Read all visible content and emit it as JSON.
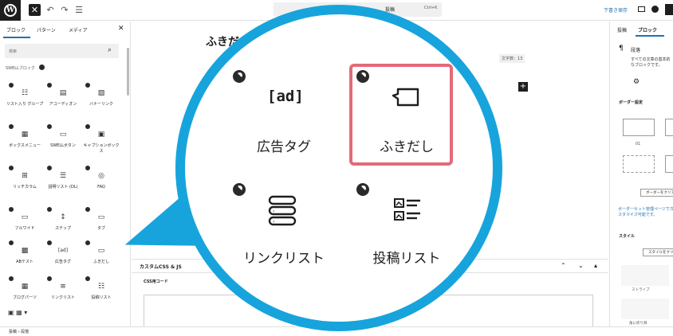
{
  "topbar": {
    "close_icon": "close-icon",
    "undo_icon": "undo-icon",
    "redo_icon": "redo-icon",
    "list_view_icon": "list-view-icon",
    "command_title": "投稿",
    "command_shortcut": "Ctrl+K",
    "draft_label": "下書き保存"
  },
  "left_sidebar": {
    "tabs": [
      "ブロック",
      "パターン",
      "メディア"
    ],
    "search_placeholder": "検索",
    "category": "SWELLブロック",
    "blocks": [
      {
        "label": "リスト入り グループ",
        "icon": "list-group-icon"
      },
      {
        "label": "アコーディオン",
        "icon": "accordion-icon"
      },
      {
        "label": "バナーリンク",
        "icon": "banner-icon"
      },
      {
        "label": "ボックスメニュー",
        "icon": "box-menu-icon"
      },
      {
        "label": "SWELLボタン",
        "icon": "button-icon"
      },
      {
        "label": "キャプションボックス",
        "icon": "caption-box-icon"
      },
      {
        "label": "リッチカラム",
        "icon": "columns-icon"
      },
      {
        "label": "説明リスト (DL)",
        "icon": "dl-icon"
      },
      {
        "label": "FAQ",
        "icon": "faq-icon"
      },
      {
        "label": "フルワイド",
        "icon": "fullwide-icon"
      },
      {
        "label": "ステップ",
        "icon": "step-icon"
      },
      {
        "label": "タブ",
        "icon": "tab-icon"
      },
      {
        "label": "ABテスト",
        "icon": "ab-test-icon"
      },
      {
        "label": "広告タグ",
        "icon": "ad-icon"
      },
      {
        "label": "ふきだし",
        "icon": "balloon-icon"
      },
      {
        "label": "ブログパーツ",
        "icon": "blog-parts-icon"
      },
      {
        "label": "リンクリスト",
        "icon": "link-list-icon"
      },
      {
        "label": "投稿リスト",
        "icon": "post-list-icon"
      }
    ]
  },
  "canvas": {
    "title": "ふきだ",
    "char_count": "文字数：13",
    "css_panel_title": "カスタムCSS & JS",
    "css_label": "CSS用コード"
  },
  "right_sidebar": {
    "tabs": [
      "投稿",
      "ブロック"
    ],
    "block_name": "段落",
    "block_desc": "すべての文章の基本的なブロックです。",
    "border_title": "ボーダー設定",
    "border_num": "01",
    "border_button": "ボーダーをクリア",
    "border_link": "ボーダーセット管理ページでカスタマイズ可能です。",
    "style_title": "スタイル",
    "style_button": "スタイルをクリア",
    "style_stripe": "ストライプ",
    "style_corner": "角に折り目"
  },
  "statusbar": {
    "breadcrumb": "投稿 › 段落"
  },
  "magnifier": {
    "items": [
      {
        "label": "広告タグ",
        "glyph": "[ad]",
        "icon": "ad-icon"
      },
      {
        "label": "ふきだし",
        "icon": "balloon-icon",
        "highlighted": true
      },
      {
        "label": "リンクリスト",
        "icon": "link-list-icon"
      },
      {
        "label": "投稿リスト",
        "icon": "post-list-icon"
      }
    ],
    "accent_color": "#17a4dc",
    "highlight_color": "#e36a78"
  }
}
